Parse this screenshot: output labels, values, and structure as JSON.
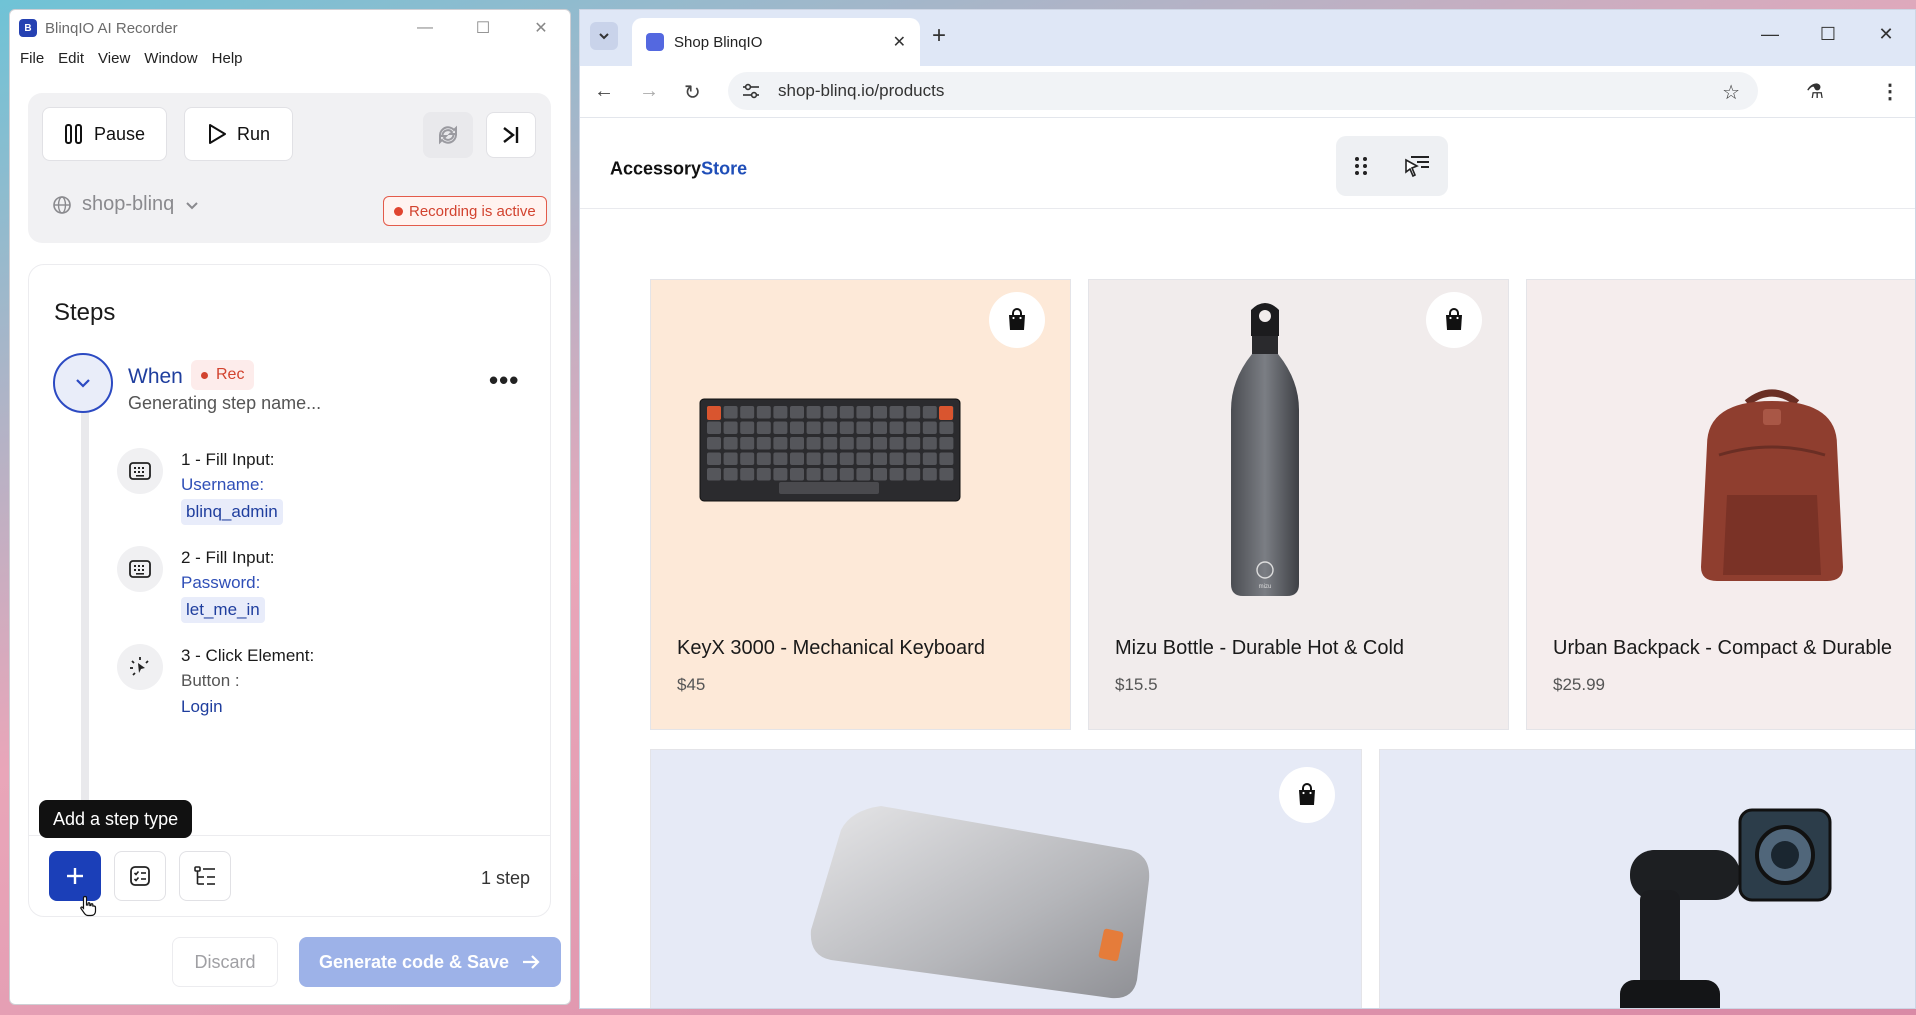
{
  "recorder": {
    "title": "BlinqIO AI Recorder",
    "logo_text": "B",
    "window_controls": [
      "—",
      "☐",
      "✕"
    ],
    "menu": [
      "File",
      "Edit",
      "View",
      "Window",
      "Help"
    ],
    "pause_label": "Pause",
    "run_label": "Run",
    "project": "shop-blinq",
    "recording_status": "Recording is active",
    "steps_title": "Steps",
    "when_label": "When",
    "rec_tag": "Rec",
    "when_sub": "Generating step name...",
    "steps": [
      {
        "num": "1 - Fill Input:",
        "field": "Username:",
        "value": "blinq_admin"
      },
      {
        "num": "2 - Fill Input:",
        "field": "Password:",
        "value": "let_me_in"
      },
      {
        "num": "3 - Click Element:",
        "field": "Button :",
        "value": "Login"
      }
    ],
    "tooltip": "Add a step type",
    "step_count": "1 step",
    "discard_label": "Discard",
    "generate_label": "Generate code & Save"
  },
  "browser": {
    "tab_title": "Shop BlinqIO",
    "url": "shop-blinq.io/products",
    "window_controls": [
      "—",
      "☐",
      "✕"
    ]
  },
  "store": {
    "logo_main": "Accessory",
    "logo_accent": "Store",
    "products": [
      {
        "name": "KeyX 3000 - Mechanical Keyboard",
        "price": "$45",
        "bg": "#fde9d8"
      },
      {
        "name": "Mizu Bottle - Durable Hot & Cold",
        "price": "$15.5",
        "bg": "#f1ecec"
      },
      {
        "name": "Urban Backpack - Compact & Durable",
        "price": "$25.99",
        "bg": "#f5eded"
      }
    ],
    "row2_bg": [
      "#e6eaf6",
      "#e6eaf6"
    ]
  },
  "colors": {
    "accent": "#1b3fb8",
    "recording_red": "#d2432f",
    "store_accent": "#1f4eb8"
  }
}
